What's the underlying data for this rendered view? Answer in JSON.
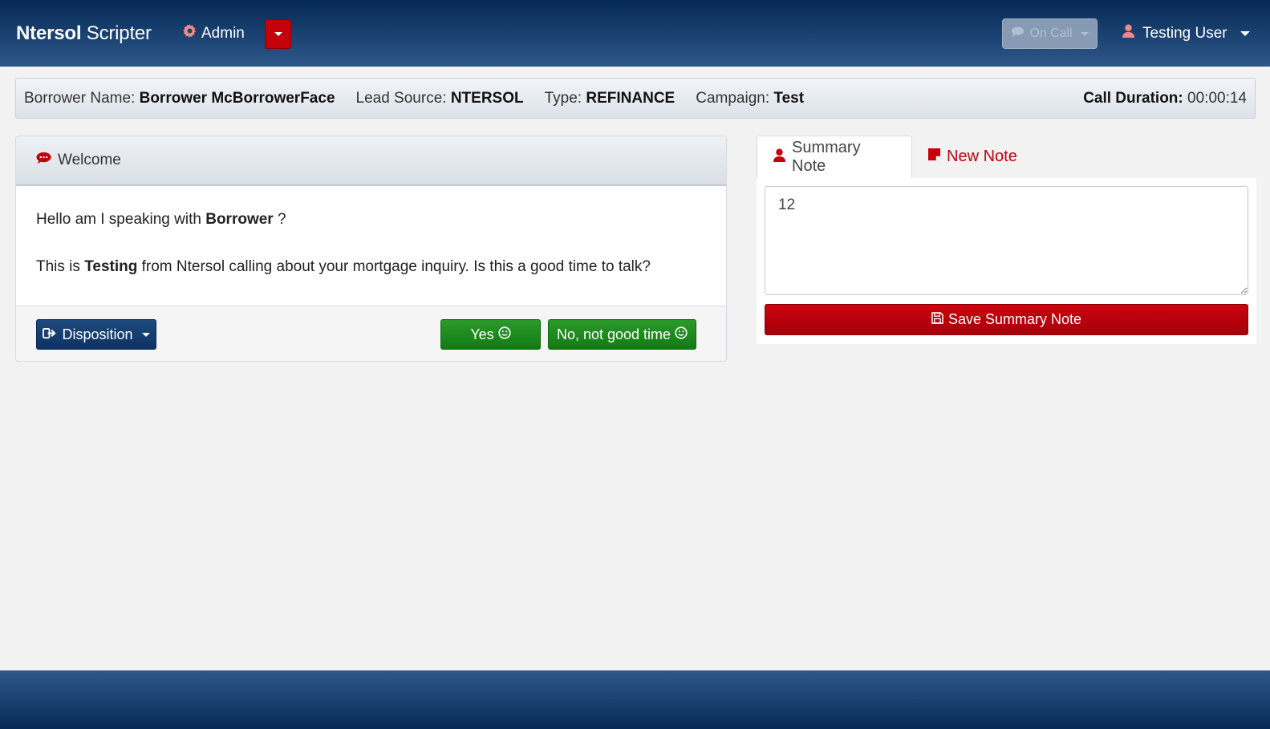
{
  "navbar": {
    "brand_bold": "Ntersol",
    "brand_light": "Scripter",
    "admin_label": "Admin",
    "oncall_label": "On Call",
    "user_label": "Testing User"
  },
  "infobar": {
    "borrower_label": "Borrower Name:",
    "borrower_value": "Borrower McBorrowerFace",
    "lead_label": "Lead Source:",
    "lead_value": "NTERSOL",
    "type_label": "Type:",
    "type_value": "REFINANCE",
    "campaign_label": "Campaign:",
    "campaign_value": "Test",
    "duration_label": "Call Duration:",
    "duration_value": "00:00:14"
  },
  "script": {
    "title": "Welcome",
    "line1_pre": "Hello am I speaking with",
    "line1_name": "Borrower",
    "line1_post": "?",
    "line2_pre": "This is",
    "line2_agent": "Testing",
    "line2_post": "from Ntersol calling about your mortgage inquiry. Is this a good time to talk?",
    "disposition_label": "Disposition",
    "yes_label": "Yes",
    "no_label": "No, not good time"
  },
  "notes": {
    "tab_summary": "Summary Note",
    "tab_new": "New Note",
    "summary_value": "12",
    "save_label": "Save Summary Note"
  },
  "colors": {
    "navy": "#062a55",
    "brand_red": "#c4000b",
    "green": "#1f8a1f"
  }
}
